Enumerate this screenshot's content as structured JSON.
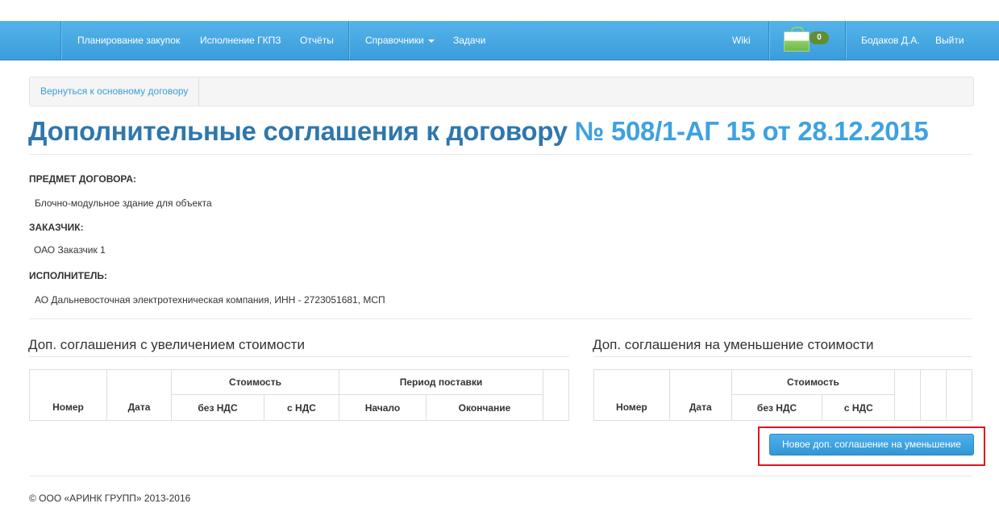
{
  "nav": {
    "items": [
      "Планирование закупок",
      "Исполнение ГКПЗ",
      "Отчёты"
    ],
    "dropdown_label": "Справочники",
    "tasks": "Задачи",
    "wiki": "Wiki",
    "cart_count": "0",
    "user": "Бодаков Д.А.",
    "logout": "Выйти"
  },
  "breadcrumb": {
    "back": "Вернуться к основному договору"
  },
  "title": {
    "part1": "Дополнительные соглашения к договору",
    "part2": "№ 508/1-АГ 15 от 28.12.2015"
  },
  "info": {
    "subject_label": "ПРЕДМЕТ ДОГОВОРА:",
    "subject_value": "Блочно-модульное здание для объекта",
    "customer_label": "ЗАКАЗЧИК:",
    "customer_value": "ОАО Заказчик 1",
    "contractor_label": "ИСПОЛНИТЕЛЬ:",
    "contractor_value": "АО Дальневосточная электротехническая компания, ИНН - 2723051681, МСП"
  },
  "increase": {
    "title": "Доп. соглашения с увеличением стоимости",
    "headers": {
      "number": "Номер",
      "date": "Дата",
      "cost": "Стоимость",
      "period": "Период поставки",
      "no_vat": "без НДС",
      "with_vat": "с НДС",
      "start": "Начало",
      "end": "Окончание"
    }
  },
  "decrease": {
    "title": "Доп. соглашения на уменьшение стоимости",
    "headers": {
      "number": "Номер",
      "date": "Дата",
      "cost": "Стоимость",
      "no_vat": "без НДС",
      "with_vat": "с НДС"
    },
    "new_button": "Новое доп. соглашение на уменьшение"
  },
  "footer": "© ООО «АРИНК ГРУПП» 2013-2016",
  "colors": {
    "nav": "#3ea2e0",
    "title_dark": "#2f77ad",
    "title_light": "#3ea2e0",
    "highlight": "#e0141e"
  }
}
